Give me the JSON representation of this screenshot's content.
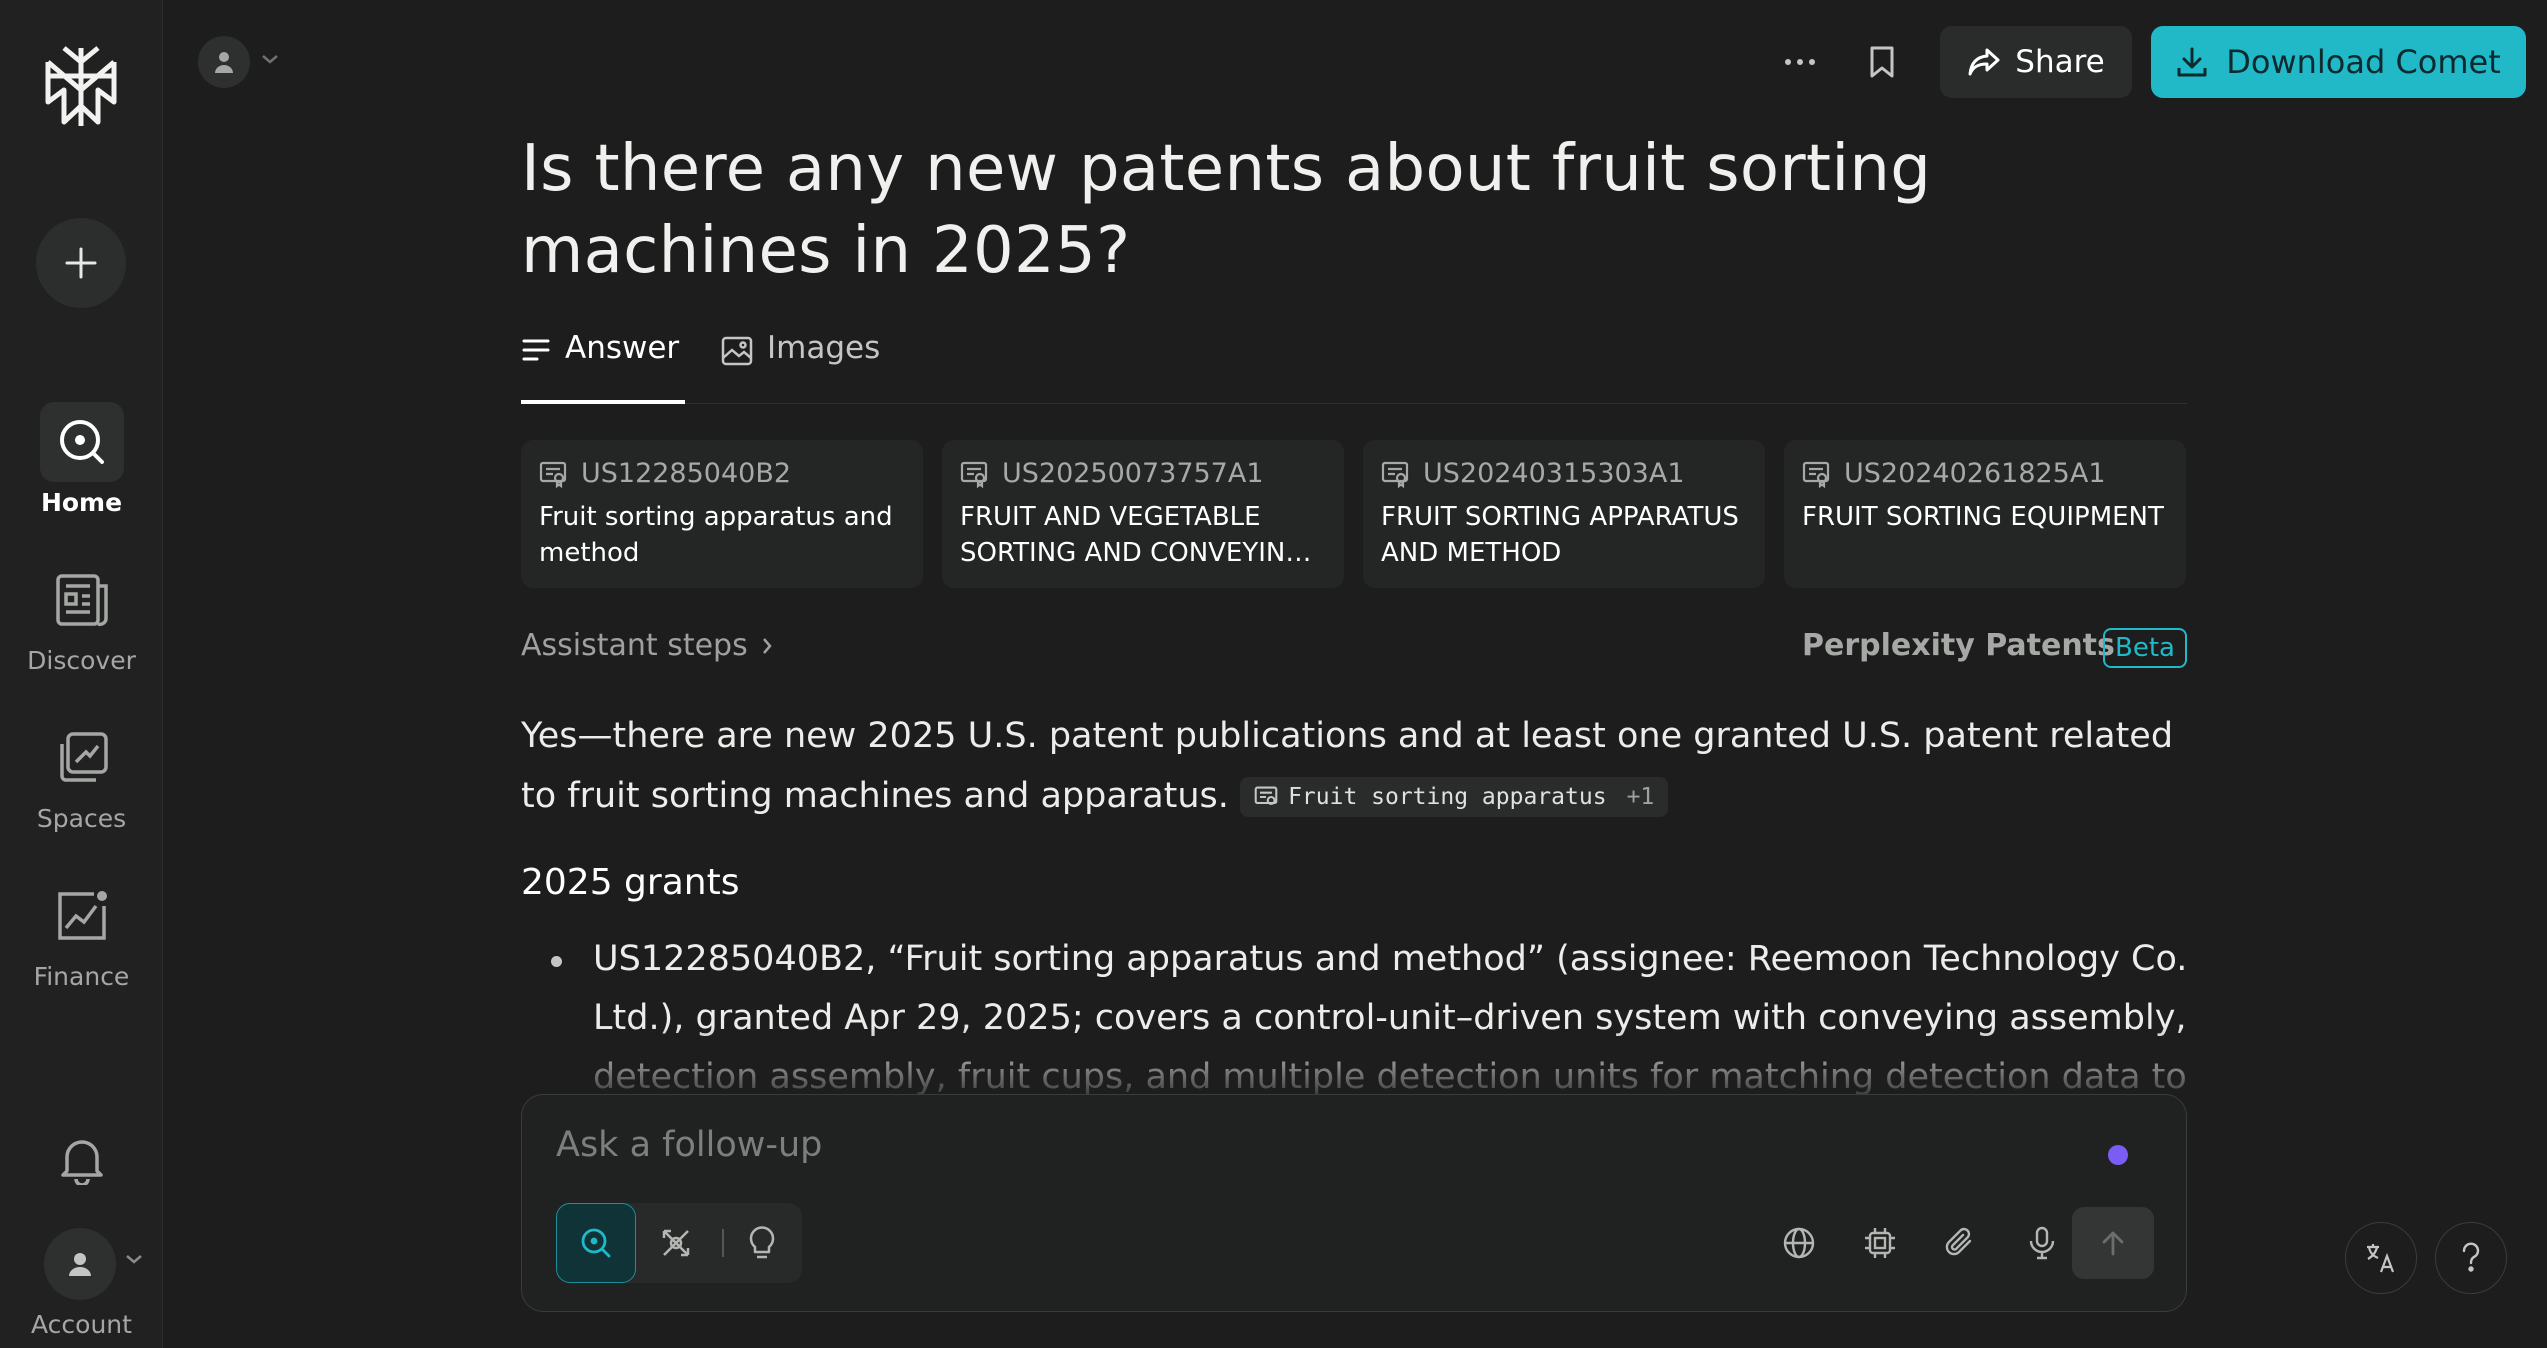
{
  "sidebar": {
    "items": [
      {
        "label": "Home",
        "icon": "search-icon"
      },
      {
        "label": "Discover",
        "icon": "newspaper-icon"
      },
      {
        "label": "Spaces",
        "icon": "spaces-icon"
      },
      {
        "label": "Finance",
        "icon": "finance-chart-icon"
      }
    ],
    "account_label": "Account"
  },
  "topbar": {
    "share_label": "Share",
    "download_label": "Download Comet"
  },
  "thread": {
    "title": "Is there any new patents about fruit sorting machines in 2025?",
    "tabs": [
      {
        "label": "Answer",
        "active": true
      },
      {
        "label": "Images",
        "active": false
      }
    ]
  },
  "sources": [
    {
      "id": "US12285040B2",
      "title": "Fruit sorting apparatus and method"
    },
    {
      "id": "US20250073757A1",
      "title": "FRUIT AND VEGETABLE SORTING AND CONVEYIN…"
    },
    {
      "id": "US20240315303A1",
      "title": "FRUIT SORTING APPARATUS AND METHOD"
    },
    {
      "id": "US20240261825A1",
      "title": "FRUIT SORTING EQUIPMENT"
    }
  ],
  "assistant_steps_label": "Assistant steps",
  "patents_label": "Perplexity Patents",
  "beta_label": "Beta",
  "answer": {
    "intro": "Yes—there are new 2025 U.S. patent publications and at least one granted U.S. patent related to fruit sorting machines and apparatus.",
    "citation_label": "Fruit sorting apparatus",
    "citation_more": "+1",
    "section_heading": "2025 grants",
    "bullets": [
      "US12285040B2, “Fruit sorting apparatus and method” (assignee: Reemoon Technology Co. Ltd.), granted Apr 29, 2025; covers a control-unit–driven system with conveying assembly, detection assembly, fruit cups, and multiple detection units for matching detection data to"
    ]
  },
  "followup": {
    "placeholder": "Ask a follow-up"
  },
  "colors": {
    "accent": "#21b8c8",
    "background": "#1c1d1c",
    "sidebar": "#202120",
    "dot": "#7b5cf5"
  }
}
